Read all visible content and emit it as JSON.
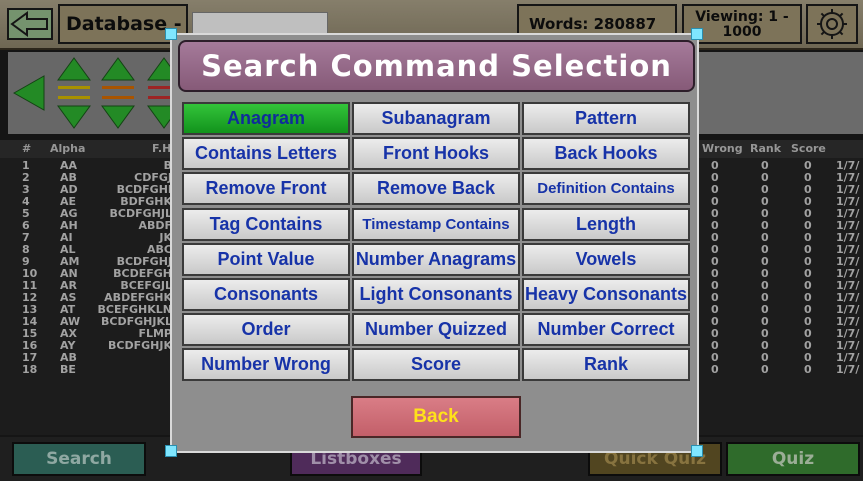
{
  "topbar": {
    "database_label": "Database -",
    "database_value": "",
    "words_label": "Words: 280887",
    "viewing_line1": "Viewing: 1 -",
    "viewing_line2": "1000"
  },
  "icons": {
    "back": "back-arrow-icon",
    "settings": "gear-icon",
    "nav": [
      "left-arrow-icon",
      "sort-up-down-icon",
      "sort-up-down-icon",
      "sort-up-down-icon"
    ]
  },
  "table": {
    "headers": [
      "#",
      "Alpha",
      "F.H",
      "Wrong",
      "Rank",
      "Score"
    ],
    "rows": [
      {
        "n": "1",
        "alpha": "AA",
        "fh": "B",
        "wrong": "0",
        "rank": "0",
        "score": "0",
        "date": "1/7/"
      },
      {
        "n": "2",
        "alpha": "AB",
        "fh": "CDFGJ",
        "wrong": "0",
        "rank": "0",
        "score": "0",
        "date": "1/7/"
      },
      {
        "n": "3",
        "alpha": "AD",
        "fh": "BCDFGHI",
        "wrong": "0",
        "rank": "0",
        "score": "0",
        "date": "1/7/"
      },
      {
        "n": "4",
        "alpha": "AE",
        "fh": "BDFGHK",
        "wrong": "0",
        "rank": "0",
        "score": "0",
        "date": "1/7/"
      },
      {
        "n": "5",
        "alpha": "AG",
        "fh": "BCDFGHJL",
        "wrong": "0",
        "rank": "0",
        "score": "0",
        "date": "1/7/"
      },
      {
        "n": "6",
        "alpha": "AH",
        "fh": "ABDF",
        "wrong": "0",
        "rank": "0",
        "score": "0",
        "date": "1/7/"
      },
      {
        "n": "7",
        "alpha": "AI",
        "fh": "JK",
        "wrong": "0",
        "rank": "0",
        "score": "0",
        "date": "1/7/"
      },
      {
        "n": "8",
        "alpha": "AL",
        "fh": "ABC",
        "wrong": "0",
        "rank": "0",
        "score": "0",
        "date": "1/7/"
      },
      {
        "n": "9",
        "alpha": "AM",
        "fh": "BCDFGHJ",
        "wrong": "0",
        "rank": "0",
        "score": "0",
        "date": "1/7/"
      },
      {
        "n": "10",
        "alpha": "AN",
        "fh": "BCDEFGH",
        "wrong": "0",
        "rank": "0",
        "score": "0",
        "date": "1/7/"
      },
      {
        "n": "11",
        "alpha": "AR",
        "fh": "BCEFGJL",
        "wrong": "0",
        "rank": "0",
        "score": "0",
        "date": "1/7/"
      },
      {
        "n": "12",
        "alpha": "AS",
        "fh": "ABDEFGHK",
        "wrong": "0",
        "rank": "0",
        "score": "0",
        "date": "1/7/"
      },
      {
        "n": "13",
        "alpha": "AT",
        "fh": "BCEFGHKLN",
        "wrong": "0",
        "rank": "0",
        "score": "0",
        "date": "1/7/"
      },
      {
        "n": "14",
        "alpha": "AW",
        "fh": "BCDFGHJKL",
        "wrong": "0",
        "rank": "0",
        "score": "0",
        "date": "1/7/"
      },
      {
        "n": "15",
        "alpha": "AX",
        "fh": "FLMP",
        "wrong": "0",
        "rank": "0",
        "score": "0",
        "date": "1/7/"
      },
      {
        "n": "16",
        "alpha": "AY",
        "fh": "BCDFGHJK",
        "wrong": "0",
        "rank": "0",
        "score": "0",
        "date": "1/7/"
      },
      {
        "n": "17",
        "alpha": "AB",
        "fh": "",
        "wrong": "0",
        "rank": "0",
        "score": "0",
        "date": "1/7/"
      },
      {
        "n": "18",
        "alpha": "BE",
        "fh": "",
        "wrong": "0",
        "rank": "0",
        "score": "0",
        "date": "1/7/"
      }
    ]
  },
  "dialog": {
    "title": "Search Command Selection",
    "commands": [
      "Anagram",
      "Subanagram",
      "Pattern",
      "Contains Letters",
      "Front Hooks",
      "Back Hooks",
      "Remove Front",
      "Remove Back",
      "Definition Contains",
      "Tag Contains",
      "Timestamp Contains",
      "Length",
      "Point Value",
      "Number Anagrams",
      "Vowels",
      "Consonants",
      "Light Consonants",
      "Heavy Consonants",
      "Order",
      "Number Quizzed",
      "Number Correct",
      "Number Wrong",
      "Score",
      "Rank"
    ],
    "active_command": "Anagram",
    "back_label": "Back"
  },
  "bottombar": {
    "search_label": "Search",
    "listboxes_label": "Listboxes",
    "quickquiz_label": "Quick Quiz",
    "quiz_label": "Quiz"
  },
  "colors": {
    "active_button": "#1fae2a",
    "command_text": "#1733a8",
    "title_bar": "#96698a",
    "back_button": "#cf6d77",
    "back_text": "#ffe21a"
  }
}
